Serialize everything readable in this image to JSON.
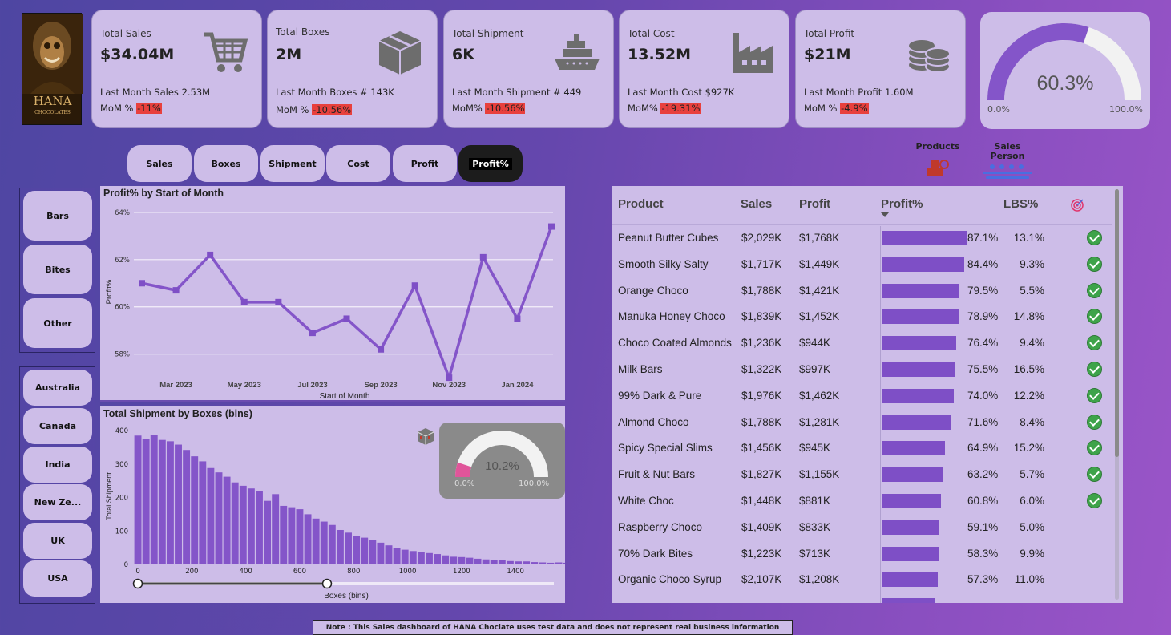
{
  "brand": {
    "name": "HANA",
    "sub": "CHOCOLATES"
  },
  "kpis": [
    {
      "title": "Total Sales",
      "value": "$34.04M",
      "last": "Last Month Sales 2.53M",
      "mom_label": "MoM % ",
      "mom_value": "-11%",
      "icon": "cart-icon"
    },
    {
      "title": "Total Boxes",
      "value": "2M",
      "last": "Last Month Boxes # 143K",
      "mom_label": "MoM % ",
      "mom_value": "-10.56%",
      "icon": "box-icon"
    },
    {
      "title": "Total Shipment",
      "value": "6K",
      "last": "Last Month Shipment # 449",
      "mom_label": "MoM% ",
      "mom_value": "-10.56%",
      "icon": "ship-icon"
    },
    {
      "title": "Total Cost",
      "value": "13.52M",
      "last": "Last Month Cost $927K",
      "mom_label": "MoM% ",
      "mom_value": "-19.31%",
      "icon": "factory-icon"
    },
    {
      "title": "Total Profit",
      "value": "$21M",
      "last": "Last Month Profit 1.60M",
      "mom_label": "MoM % ",
      "mom_value": "-4.9%",
      "icon": "coins-icon"
    }
  ],
  "gauge_main": {
    "value": 0.603,
    "label": "60.3%",
    "min": "0.0%",
    "max": "100.0%"
  },
  "tabs": [
    "Sales",
    "Boxes",
    "Shipment",
    "Cost",
    "Profit",
    "Profit%"
  ],
  "active_tab": "Profit%",
  "view_toggle": {
    "products": "Products",
    "sales_person_1": "Sales",
    "sales_person_2": "Person"
  },
  "categories": [
    "Bars",
    "Bites",
    "Other"
  ],
  "countries": [
    "Australia",
    "Canada",
    "India",
    "New Ze...",
    "UK",
    "USA"
  ],
  "line_chart_title": "Profit% by Start of Month",
  "histogram_title": "Total Shipment by Boxes (bins)",
  "gauge_small": {
    "value": 0.102,
    "label": "10.2%",
    "min": "0.0%",
    "max": "100.0%"
  },
  "chart_data": [
    {
      "type": "line",
      "title": "Profit% by Start of Month",
      "xlabel": "Start of Month",
      "ylabel": "Profit%",
      "x": [
        "Feb 2023",
        "Mar 2023",
        "Apr 2023",
        "May 2023",
        "Jun 2023",
        "Jul 2023",
        "Aug 2023",
        "Sep 2023",
        "Oct 2023",
        "Nov 2023",
        "Dec 2023",
        "Jan 2024",
        "Feb 2024"
      ],
      "x_ticks": [
        "Mar 2023",
        "May 2023",
        "Jul 2023",
        "Sep 2023",
        "Nov 2023",
        "Jan 2024"
      ],
      "y_ticks": [
        "58%",
        "60%",
        "62%",
        "64%"
      ],
      "values": [
        61.0,
        60.7,
        62.2,
        60.2,
        60.2,
        58.9,
        59.5,
        58.2,
        60.9,
        57.0,
        62.1,
        59.5,
        63.4
      ],
      "ylim": [
        56.8,
        64.2
      ],
      "grid": true
    },
    {
      "type": "bar",
      "title": "Total Shipment by Boxes (bins)",
      "xlabel": "Boxes (bins)",
      "ylabel": "Total Shipment",
      "x_ticks": [
        "0",
        "200",
        "400",
        "600",
        "800",
        "1000",
        "1200",
        "1400"
      ],
      "y_ticks": [
        "0",
        "100",
        "200",
        "300",
        "400"
      ],
      "bin_width": 30,
      "xlim": [
        -15,
        1560
      ],
      "ylim": [
        0,
        400
      ],
      "values": [
        385,
        375,
        388,
        372,
        368,
        358,
        342,
        323,
        308,
        288,
        275,
        262,
        245,
        235,
        227,
        218,
        190,
        210,
        175,
        171,
        165,
        150,
        137,
        128,
        118,
        103,
        95,
        86,
        80,
        73,
        65,
        57,
        50,
        44,
        40,
        38,
        34,
        31,
        27,
        23,
        22,
        20,
        17,
        15,
        13,
        12,
        10,
        9,
        9,
        7,
        6,
        5,
        6,
        5,
        4,
        5,
        4,
        3,
        4,
        3,
        3,
        2,
        3,
        2,
        2,
        2
      ]
    }
  ],
  "table": {
    "headers": {
      "product": "Product",
      "sales": "Sales",
      "profit": "Profit",
      "profit_pct": "Profit%",
      "lbs": "LBS%"
    },
    "rows": [
      {
        "product": "Peanut Butter Cubes",
        "sales": "$2,029K",
        "profit": "$1,768K",
        "pct": "87.1%",
        "pct_val": 87.1,
        "lbs": "13.1%",
        "ok": true
      },
      {
        "product": "Smooth Silky Salty",
        "sales": "$1,717K",
        "profit": "$1,449K",
        "pct": "84.4%",
        "pct_val": 84.4,
        "lbs": "9.3%",
        "ok": true
      },
      {
        "product": "Orange Choco",
        "sales": "$1,788K",
        "profit": "$1,421K",
        "pct": "79.5%",
        "pct_val": 79.5,
        "lbs": "5.5%",
        "ok": true
      },
      {
        "product": "Manuka Honey Choco",
        "sales": "$1,839K",
        "profit": "$1,452K",
        "pct": "78.9%",
        "pct_val": 78.9,
        "lbs": "14.8%",
        "ok": true
      },
      {
        "product": "Choco Coated Almonds",
        "sales": "$1,236K",
        "profit": "$944K",
        "pct": "76.4%",
        "pct_val": 76.4,
        "lbs": "9.4%",
        "ok": true
      },
      {
        "product": "Milk Bars",
        "sales": "$1,322K",
        "profit": "$997K",
        "pct": "75.5%",
        "pct_val": 75.5,
        "lbs": "16.5%",
        "ok": true
      },
      {
        "product": "99% Dark & Pure",
        "sales": "$1,976K",
        "profit": "$1,462K",
        "pct": "74.0%",
        "pct_val": 74.0,
        "lbs": "12.2%",
        "ok": true
      },
      {
        "product": "Almond Choco",
        "sales": "$1,788K",
        "profit": "$1,281K",
        "pct": "71.6%",
        "pct_val": 71.6,
        "lbs": "8.4%",
        "ok": true
      },
      {
        "product": "Spicy Special Slims",
        "sales": "$1,456K",
        "profit": "$945K",
        "pct": "64.9%",
        "pct_val": 64.9,
        "lbs": "15.2%",
        "ok": true
      },
      {
        "product": "Fruit & Nut Bars",
        "sales": "$1,827K",
        "profit": "$1,155K",
        "pct": "63.2%",
        "pct_val": 63.2,
        "lbs": "5.7%",
        "ok": true
      },
      {
        "product": "White Choc",
        "sales": "$1,448K",
        "profit": "$881K",
        "pct": "60.8%",
        "pct_val": 60.8,
        "lbs": "6.0%",
        "ok": true
      },
      {
        "product": "Raspberry Choco",
        "sales": "$1,409K",
        "profit": "$833K",
        "pct": "59.1%",
        "pct_val": 59.1,
        "lbs": "5.0%",
        "ok": false
      },
      {
        "product": "70% Dark Bites",
        "sales": "$1,223K",
        "profit": "$713K",
        "pct": "58.3%",
        "pct_val": 58.3,
        "lbs": "9.9%",
        "ok": false
      },
      {
        "product": "Organic Choco Syrup",
        "sales": "$2,107K",
        "profit": "$1,208K",
        "pct": "57.3%",
        "pct_val": 57.3,
        "lbs": "11.0%",
        "ok": false
      }
    ]
  },
  "note": "Note : This Sales dashboard of HANA Choclate uses test data and does not represent real business information",
  "colors": {
    "accent": "#7e4fc6",
    "panel": "#cdbde8",
    "negative": "#e8403d",
    "success": "#3ea34a",
    "gauge_small": "#e0559a"
  }
}
